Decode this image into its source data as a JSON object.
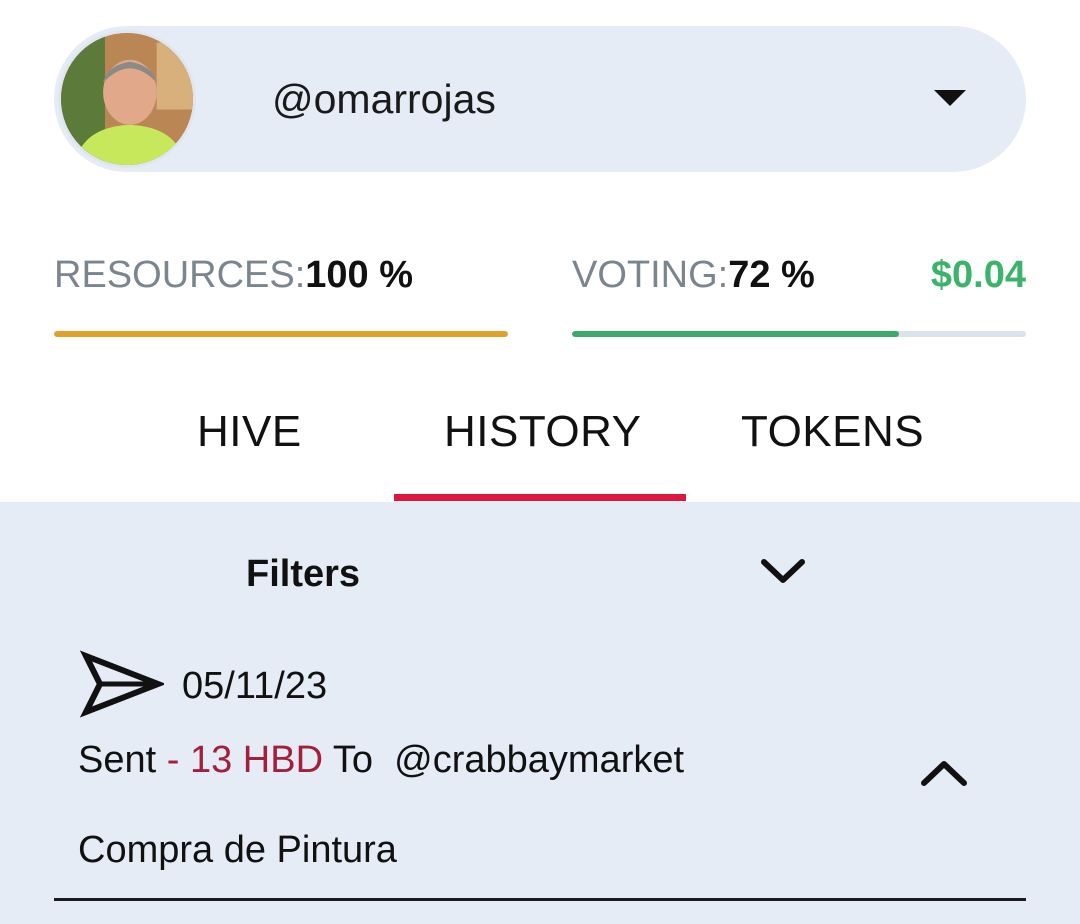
{
  "account": {
    "username": "@omarrojas",
    "avatar": "user-avatar",
    "dropdown_icon": "caret-down-icon"
  },
  "stats": {
    "resources_label": "RESOURCES:",
    "resources_value": "100 %",
    "resources_fraction": 1.0,
    "voting_label": "VOTING:",
    "voting_value": "72 %",
    "voting_fraction": 0.72,
    "voting_dollar": "$0.04"
  },
  "tabs": [
    {
      "label": "HIVE",
      "active": false
    },
    {
      "label": "HISTORY",
      "active": true
    },
    {
      "label": "TOKENS",
      "active": false
    }
  ],
  "filters": {
    "label": "Filters",
    "icon": "chevron-down-icon"
  },
  "transactions": [
    {
      "icon": "send-icon",
      "date": "05/11/23",
      "action": "Sent",
      "separator": " - ",
      "amount": "13 HBD",
      "to_label": " To  ",
      "to": "@crabbaymarket",
      "memo": "Compra de Pintura",
      "toggle_icon": "chevron-up-icon"
    }
  ],
  "colors": {
    "pill_bg": "#e6ecf5",
    "resources_bar": "#e0a12b",
    "voting_bar": "#3ea96a",
    "voting_dollar": "#3bb36a",
    "active_tab_underline": "#e0163e",
    "amount_sent": "#a3203a"
  }
}
